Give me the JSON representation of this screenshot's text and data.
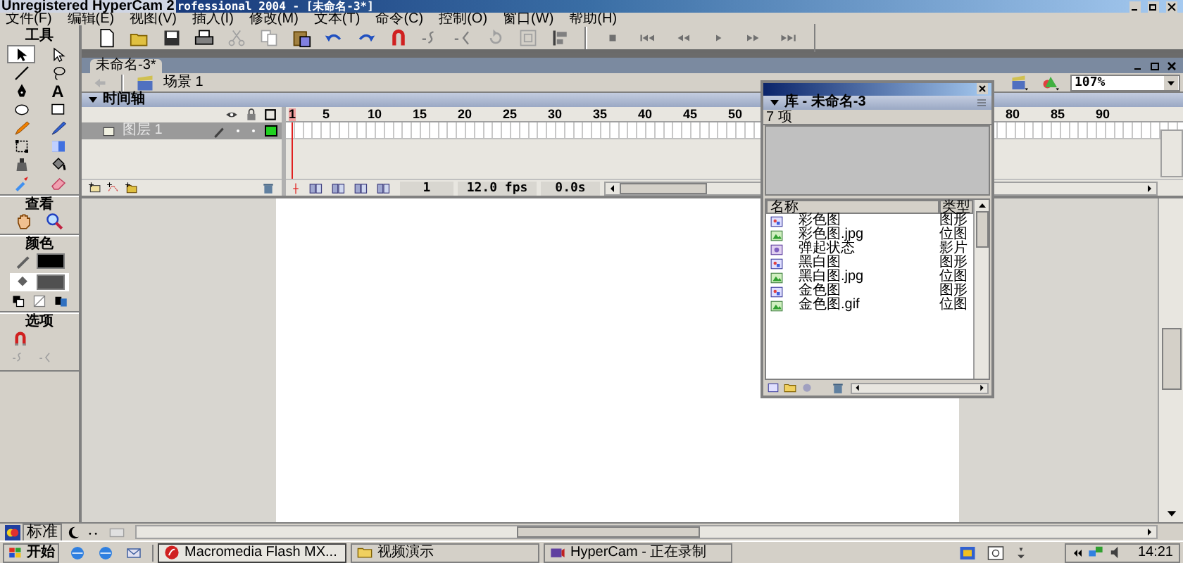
{
  "title_bar": {
    "overlay_text": "Unregistered HyperCam 2",
    "title": "rofessional 2004 - [未命名-3*]"
  },
  "menu": [
    "文件(F)",
    "编辑(E)",
    "视图(V)",
    "插入(I)",
    "修改(M)",
    "文本(T)",
    "命令(C)",
    "控制(O)",
    "窗口(W)",
    "帮助(H)"
  ],
  "tools_panel": {
    "heading": "工具",
    "tools": [
      {
        "selected": true
      },
      {
        "selected": false
      },
      {
        "selected": false
      },
      {
        "selected": false
      },
      {
        "selected": false
      },
      {
        "selected": false,
        "glyph": "A"
      },
      {
        "selected": false
      },
      {
        "selected": false
      },
      {
        "selected": false
      },
      {
        "selected": false
      },
      {
        "selected": false
      },
      {
        "selected": false
      },
      {
        "selected": false
      },
      {
        "selected": false
      },
      {
        "selected": false
      },
      {
        "selected": false
      }
    ],
    "view_heading": "查看",
    "colors_heading": "颜色",
    "options_heading": "选项"
  },
  "document": {
    "tab": "未命名-3*",
    "scene": "场景 1",
    "zoom": "107%"
  },
  "timeline": {
    "title": "时间轴",
    "ruler": [
      "1",
      "5",
      "10",
      "15",
      "20",
      "25",
      "30",
      "35",
      "40",
      "45",
      "50",
      "80",
      "85",
      "90"
    ],
    "layers": [
      {
        "name": "图层 1",
        "selected": true
      }
    ],
    "current_frame": "1",
    "frame_rate": "12.0 fps",
    "elapsed": "0.0s"
  },
  "library": {
    "title": "库 - 未命名-3",
    "count": "7 项",
    "columns": [
      "名称",
      "类型"
    ],
    "items": [
      {
        "name": "彩色图",
        "type": "图形",
        "kind": "graphic"
      },
      {
        "name": "彩色图.jpg",
        "type": "位图",
        "kind": "bitmap"
      },
      {
        "name": "弹起状态",
        "type": "影片",
        "kind": "movie"
      },
      {
        "name": "黑白图",
        "type": "图形",
        "kind": "graphic"
      },
      {
        "name": "黑白图.jpg",
        "type": "位图",
        "kind": "bitmap"
      },
      {
        "name": "金色图",
        "type": "图形",
        "kind": "graphic"
      },
      {
        "name": "金色图.gif",
        "type": "位图",
        "kind": "bitmap"
      }
    ]
  },
  "bottom_tab": "标准",
  "taskbar": {
    "start": "开始",
    "tasks": [
      {
        "label": "Macromedia Flash MX...",
        "selected": true
      },
      {
        "label": "视频演示",
        "selected": false
      },
      {
        "label": "HyperCam - 正在录制",
        "selected": false
      }
    ],
    "clock": "14:21"
  }
}
